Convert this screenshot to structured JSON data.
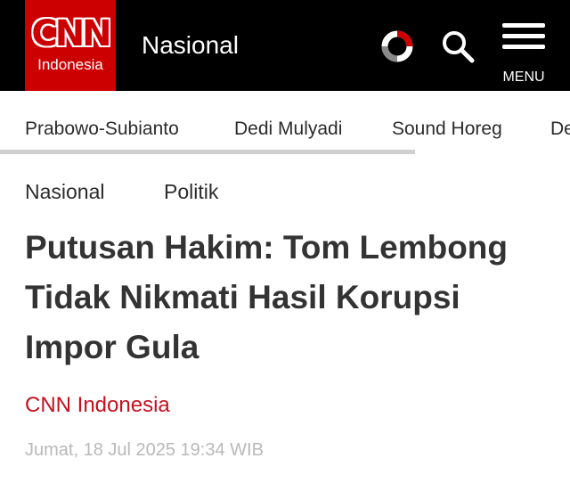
{
  "header": {
    "logo": {
      "wordmark": "CNN",
      "subtitle": "Indonesia"
    },
    "section_title": "Nasional",
    "live_icon": "live-circle-icon",
    "search_icon": "search-icon",
    "menu": {
      "icon": "hamburger-icon",
      "label": "MENU"
    },
    "colors": {
      "brand_red": "#cc0000",
      "bar": "#000000"
    }
  },
  "topics": [
    "Prabowo-Subianto",
    "Dedi Mulyadi",
    "Sound Horeg",
    "Dedi Mulyadi"
  ],
  "breadcrumb": [
    "Nasional",
    "Politik"
  ],
  "article": {
    "headline": "Putusan Hakim: Tom Lembong Tidak Nikmati Hasil Korupsi Impor Gula",
    "author": "CNN Indonesia",
    "date": "Jumat, 18 Jul 2025 19:34 WIB"
  }
}
